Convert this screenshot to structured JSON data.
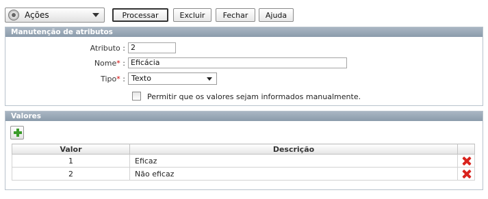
{
  "toolbar": {
    "actions_label": "Ações",
    "buttons": {
      "processar": "Processar",
      "excluir": "Excluir",
      "fechar": "Fechar",
      "ajuda": "Ajuda"
    }
  },
  "manutencao": {
    "title": "Manutenção de atributos",
    "atributo": {
      "label": "Atributo :",
      "value": "2"
    },
    "nome": {
      "label": "Nome",
      "required_mark": "*",
      "sep": ":",
      "value": "Eficácia"
    },
    "tipo": {
      "label": "Tipo",
      "required_mark": "*",
      "sep": ":",
      "selected": "Texto"
    },
    "manual": {
      "label": "Permitir que os valores sejam informados manualmente.",
      "checked": false
    }
  },
  "valores": {
    "title": "Valores",
    "columns": [
      "Valor",
      "Descrição"
    ],
    "rows": [
      {
        "valor": "1",
        "descricao": "Eficaz"
      },
      {
        "valor": "2",
        "descricao": "Não eficaz"
      }
    ]
  },
  "colors": {
    "panel_header": "#8b9bab",
    "required": "#d00000",
    "add_icon": "#3b9c2a",
    "delete_icon": "#d9231d"
  },
  "icons": {
    "actions": "gear-icon",
    "add": "plus-icon",
    "delete": "delete-x-icon"
  }
}
